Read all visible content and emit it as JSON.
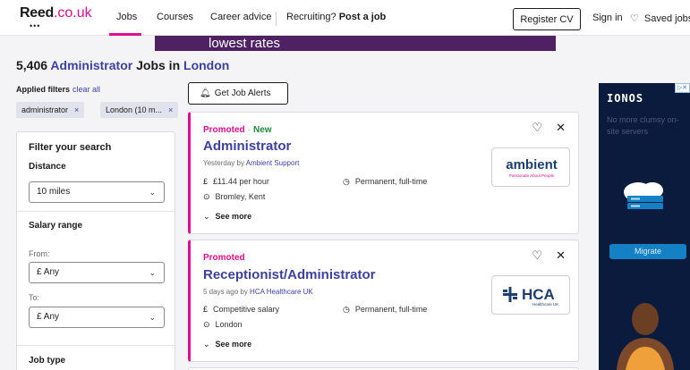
{
  "header": {
    "logo_text": "Reed",
    "logo_suffix": ".co.uk",
    "nav": [
      "Jobs",
      "Courses",
      "Career advice"
    ],
    "recruiting_prefix": "Recruiting?",
    "recruiting_link": "Post a job",
    "register_cv": "Register CV",
    "sign_in": "Sign in",
    "saved_jobs": "Saved jobs"
  },
  "banner": {
    "text": "lowest rates"
  },
  "page": {
    "count": "5,406",
    "keyword": "Administrator",
    "jobs_in": "Jobs in",
    "location": "London"
  },
  "applied_filters": {
    "label": "Applied filters",
    "clear": "clear all",
    "chips": [
      "administrator",
      "London (10 m..."
    ]
  },
  "filters": {
    "title": "Filter your search",
    "distance_label": "Distance",
    "distance_value": "10 miles",
    "salary_label": "Salary range",
    "from_label": "From:",
    "from_value": "£ Any",
    "to_label": "To:",
    "to_value": "£ Any",
    "job_type_label": "Job type"
  },
  "job_alerts": "Get Job Alerts",
  "jobs": [
    {
      "promoted": "Promoted",
      "new": "New",
      "title": "Administrator",
      "posted": "Yesterday by",
      "company": "Ambient Support",
      "salary": "£11.44 per hour",
      "type": "Permanent, full-time",
      "location": "Bromley, Kent",
      "see_more": "See more",
      "logo_name": "ambient",
      "logo_tagline": "Passionate About People"
    },
    {
      "promoted": "Promoted",
      "title": "Receptionist/Administrator",
      "posted": "5 days ago by",
      "company": "HCA Healthcare UK",
      "salary": "Competitive salary",
      "type": "Permanent, full-time",
      "location": "London",
      "see_more": "See more",
      "logo_name": "HCA",
      "logo_tagline": "Healthcare UK"
    }
  ],
  "ad": {
    "brand": "IONOS",
    "text": "No more clumsy on-site servers",
    "cta": "Migrate"
  },
  "colors": {
    "brand_pink": "#e10d8c",
    "link_blue": "#3d3fa1",
    "new_green": "#1d8a3b",
    "banner_purple": "#4f2162"
  }
}
